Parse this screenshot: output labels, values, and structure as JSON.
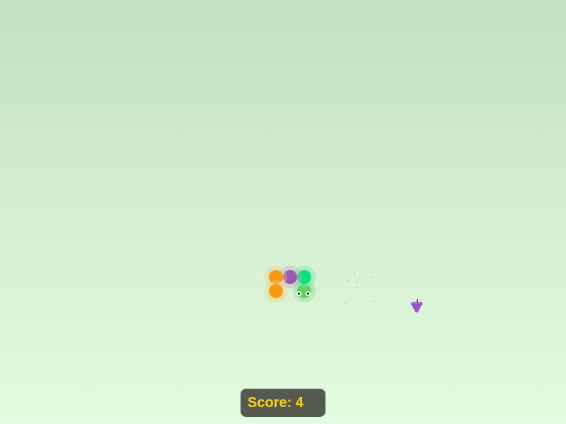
{
  "game": {
    "colors": {
      "background_top": "#c3e1c2",
      "background_bottom": "#e3fbe0",
      "score_panel": "#545a4e",
      "score_text": "#ffd21f"
    },
    "snake": {
      "segments": [
        {
          "role": "head",
          "color": "#5fd35a",
          "glow": "#7ad87a"
        },
        {
          "role": "body",
          "color": "#11e27e",
          "glow": "#62e6a4"
        },
        {
          "role": "body",
          "color": "#9b59b6",
          "glow": "#b9a3c6"
        },
        {
          "role": "body",
          "color": "#f59b12",
          "glow": "#f2c87b"
        },
        {
          "role": "tail",
          "color": "#f59b12",
          "glow": "#f2c87b"
        }
      ]
    },
    "food": {
      "icon": "grapes-icon",
      "color": "#9b4fd1"
    },
    "score": {
      "label": "Score: 4"
    }
  }
}
